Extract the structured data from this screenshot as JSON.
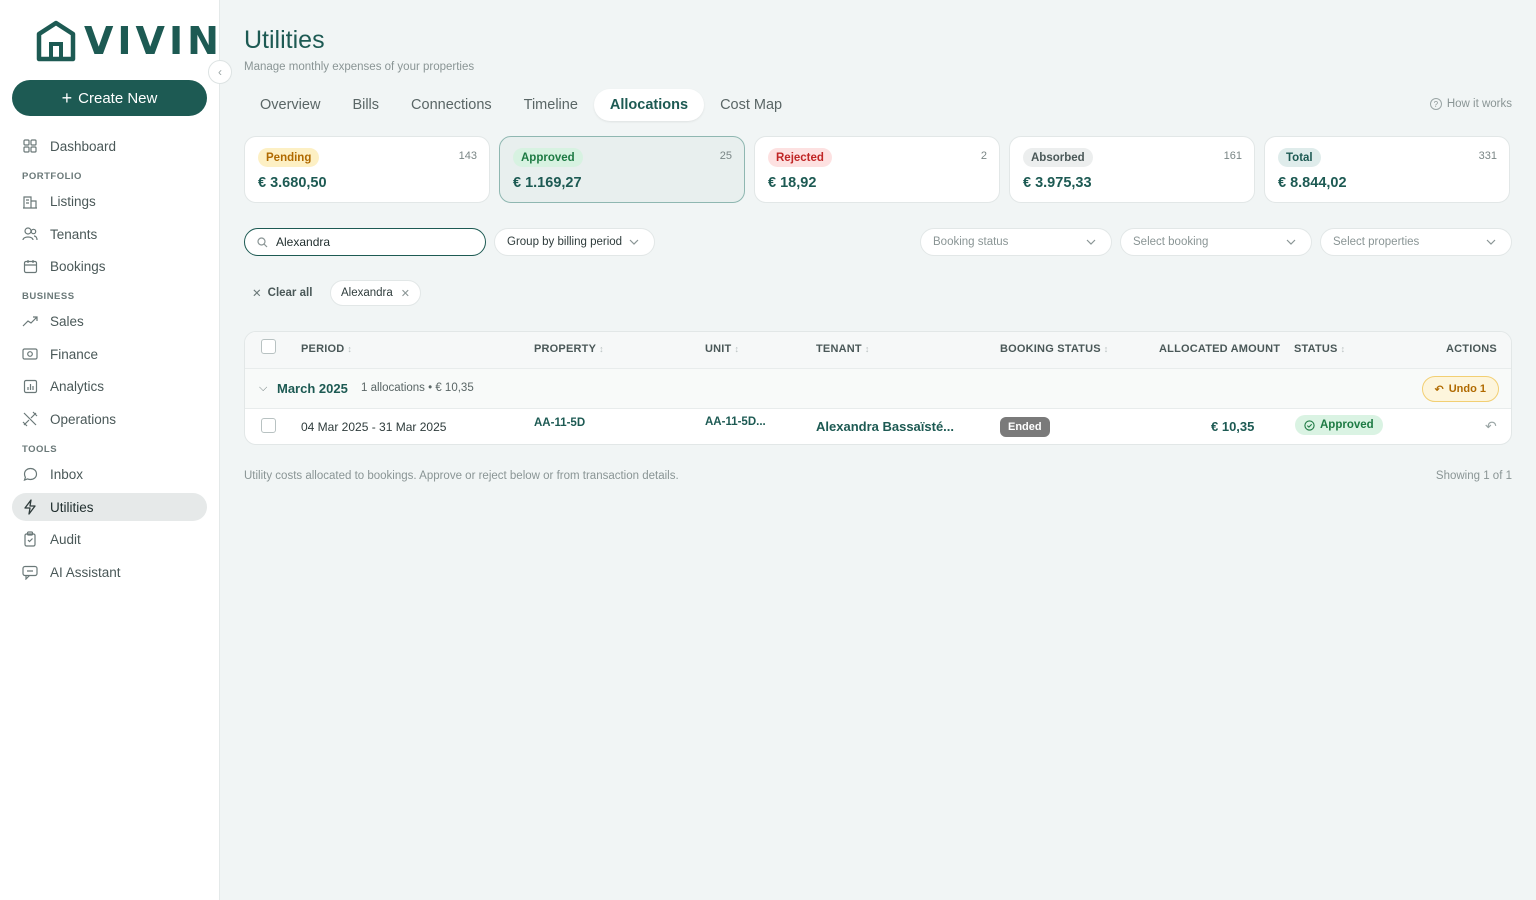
{
  "sidebar": {
    "logo_text": "VIVIN",
    "create_label": "Create New",
    "items": [
      {
        "label": "Dashboard",
        "icon": "grid-icon"
      },
      {
        "label": "Listings",
        "icon": "building-icon"
      },
      {
        "label": "Tenants",
        "icon": "users-icon"
      },
      {
        "label": "Bookings",
        "icon": "calendar-icon"
      },
      {
        "label": "Sales",
        "icon": "trend-icon"
      },
      {
        "label": "Finance",
        "icon": "cash-icon"
      },
      {
        "label": "Analytics",
        "icon": "bar-chart-icon"
      },
      {
        "label": "Operations",
        "icon": "tools-icon"
      },
      {
        "label": "Inbox",
        "icon": "chat-icon"
      },
      {
        "label": "Utilities",
        "icon": "bolt-icon"
      },
      {
        "label": "Audit",
        "icon": "clipboard-icon"
      },
      {
        "label": "AI Assistant",
        "icon": "ai-chat-icon"
      }
    ],
    "sections": {
      "portfolio": "PORTFOLIO",
      "business": "BUSINESS",
      "tools": "TOOLS"
    }
  },
  "header": {
    "title": "Utilities",
    "subtitle": "Manage monthly expenses of your properties",
    "how_it_works": "How it works"
  },
  "tabs": [
    "Overview",
    "Bills",
    "Connections",
    "Timeline",
    "Allocations",
    "Cost Map"
  ],
  "active_tab": "Allocations",
  "cards": [
    {
      "label": "Pending",
      "count": "143",
      "amount": "€ 3.680,50",
      "badge_bg": "#fdf0c4",
      "badge_fg": "#b06a00"
    },
    {
      "label": "Approved",
      "count": "25",
      "amount": "€ 1.169,27",
      "badge_bg": "#d7f2e1",
      "badge_fg": "#1d7a43"
    },
    {
      "label": "Rejected",
      "count": "2",
      "amount": "€ 18,92",
      "badge_bg": "#fde1e1",
      "badge_fg": "#c02626"
    },
    {
      "label": "Absorbed",
      "count": "161",
      "amount": "€ 3.975,33",
      "badge_bg": "#eceeee",
      "badge_fg": "#4a5858"
    },
    {
      "label": "Total",
      "count": "331",
      "amount": "€ 8.844,02",
      "badge_bg": "#dfeceb",
      "badge_fg": "#1d5a53"
    }
  ],
  "filters": {
    "search_value": "Alexandra",
    "group_by": "Group by billing period",
    "booking_status": "Booking status",
    "select_booking": "Select booking",
    "select_properties": "Select properties",
    "clear_all": "Clear all",
    "chip": "Alexandra"
  },
  "table": {
    "headers": [
      "PERIOD",
      "PROPERTY",
      "UNIT",
      "TENANT",
      "BOOKING STATUS",
      "ALLOCATED AMOUNT",
      "STATUS",
      "ACTIONS"
    ],
    "group": {
      "title": "March 2025",
      "meta": "1 allocations • € 10,35",
      "undo": "Undo 1"
    },
    "row": {
      "period": "04 Mar 2025 - 31 Mar 2025",
      "property": "AA-11-5D",
      "unit": "AA-11-5D...",
      "tenant": "Alexandra Bassaïsté...",
      "booking_status": "Ended",
      "amount": "€ 10,35",
      "status": "Approved"
    }
  },
  "footer": {
    "note": "Utility costs allocated to bookings. Approve or reject below or from transaction details.",
    "count": "Showing 1 of 1"
  },
  "colors": {
    "brand": "#1d5a53",
    "background": "#f1f5f5"
  }
}
